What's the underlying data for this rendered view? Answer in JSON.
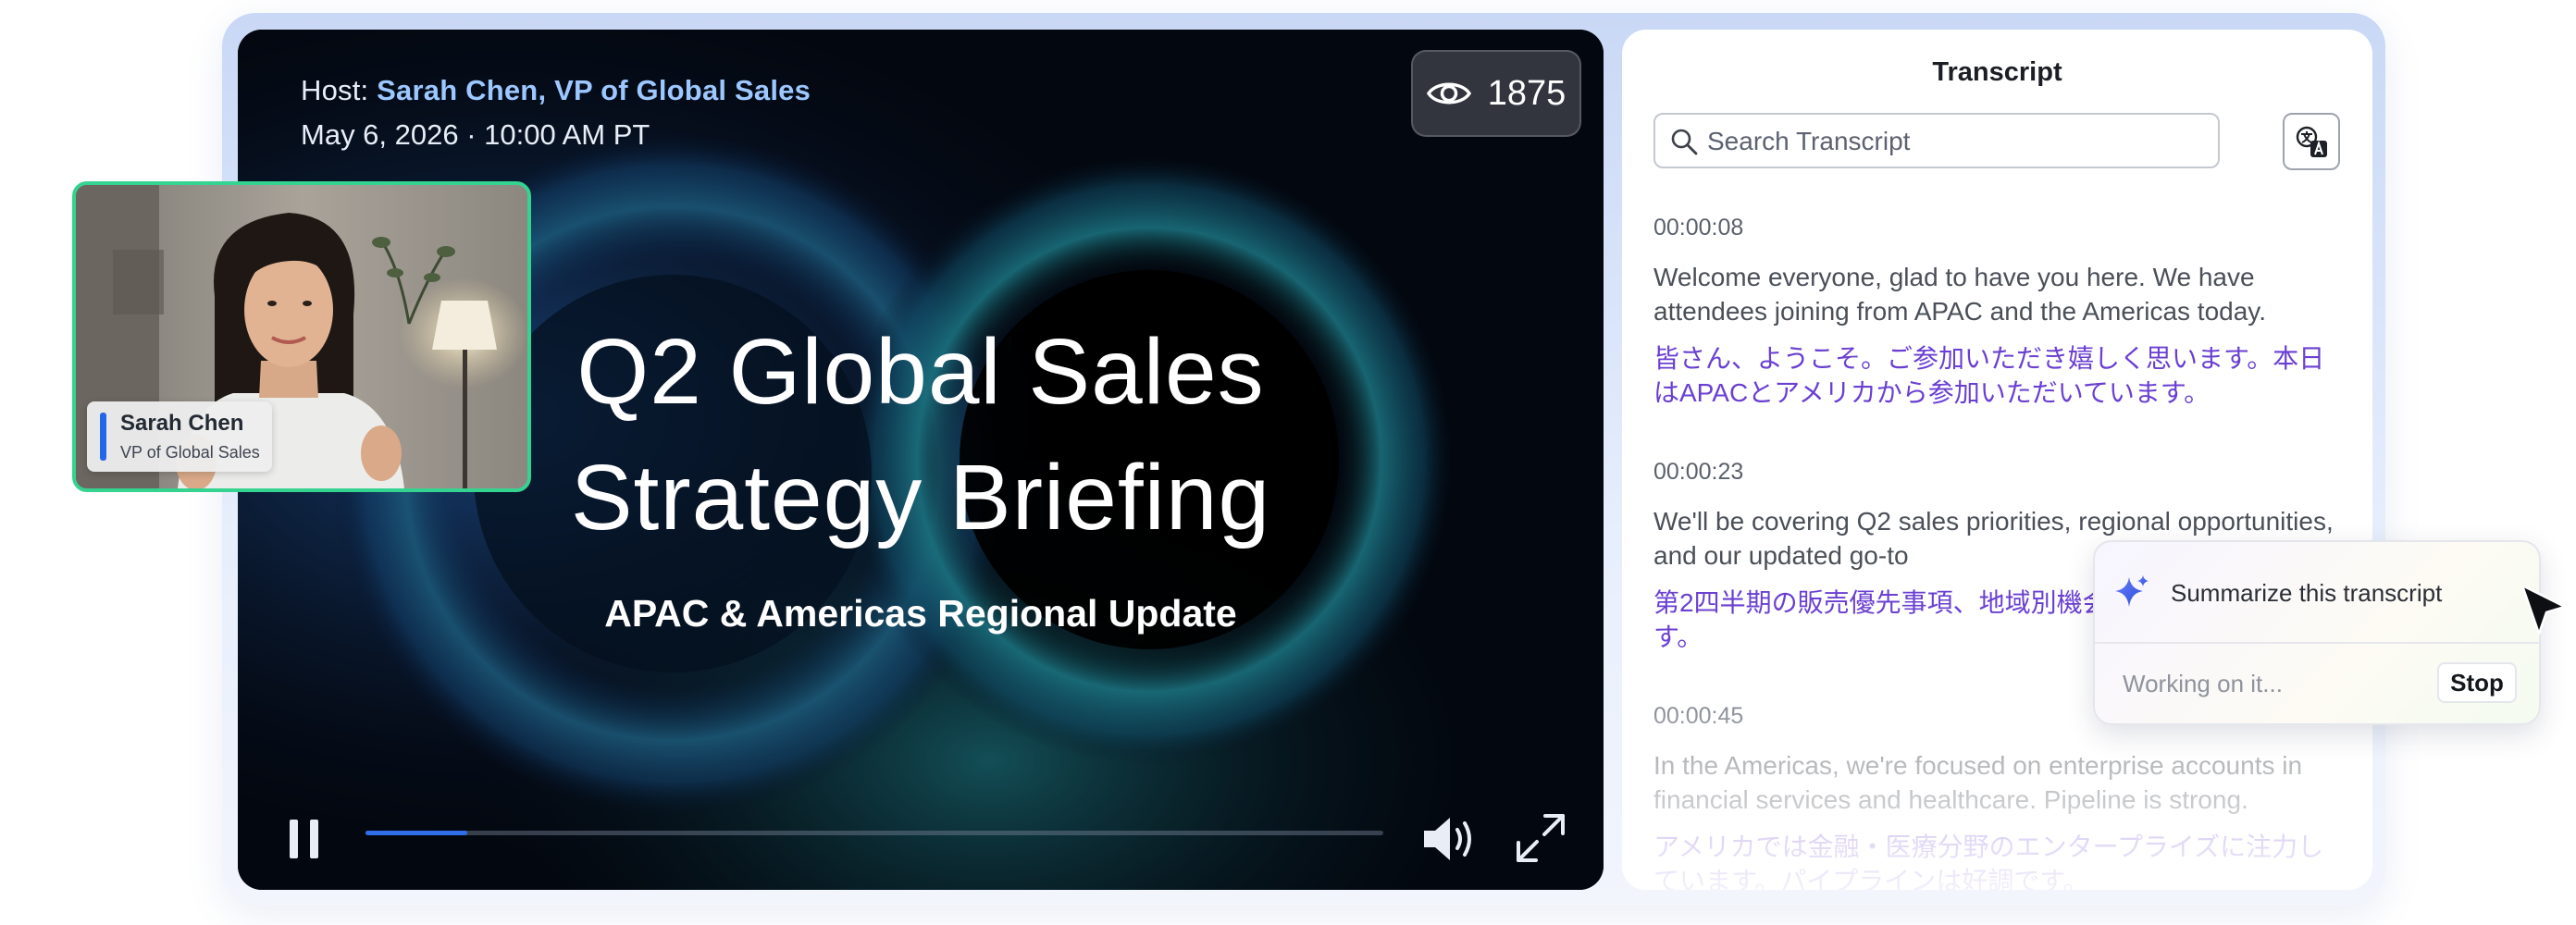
{
  "video": {
    "host_prefix": "Host: ",
    "host_name": "Sarah Chen, VP of Global Sales",
    "date_time": "May 6, 2026 · 10:00 AM PT",
    "viewer_count": "1875",
    "viewer_icon": "eye-icon",
    "title_line1": "Q2 Global Sales",
    "title_line2": "Strategy Briefing",
    "subtitle": "APAC & Americas Regional Update",
    "playback_state": "playing",
    "progress_fraction": 0.1,
    "progress_color": "#2f6ee8",
    "controls": {
      "pause_icon": "pause-icon",
      "volume_icon": "volume-icon",
      "fullscreen_icon": "fullscreen-icon"
    }
  },
  "pip": {
    "name": "Sarah Chen",
    "role": "VP of Global Sales",
    "border_color": "#35d390",
    "accent_color": "#2466ea"
  },
  "transcript": {
    "title": "Transcript",
    "search_placeholder": "Search Transcript",
    "search_value": "",
    "translate_icon": "translate-icon",
    "entries": [
      {
        "timestamp": "00:00:08",
        "text_en": "Welcome everyone, glad to have you here. We have attendees joining from APAC and the Americas today.",
        "text_ja": "皆さん、ようこそ。ご参加いただき嬉しく思います。本日はAPACとアメリカから参加いただいています。"
      },
      {
        "timestamp": "00:00:23",
        "text_en": "We'll be covering Q2 sales priorities, regional opportunities, and our updated go-to",
        "text_ja": "第2四半期の販売優先事項、地域別機会、ついてご説明します。"
      },
      {
        "timestamp": "00:00:45",
        "text_en": "In the Americas, we're focused on enterprise accounts in financial services and healthcare. Pipeline is strong.",
        "text_ja": "アメリカでは金融・医療分野のエンタープライズに注力しています。パイプラインは好調です。"
      }
    ]
  },
  "ai": {
    "summarize_label": "Summarize this transcript",
    "sparkle_icon": "sparkle-icon",
    "status": "Working on it...",
    "stop_label": "Stop"
  },
  "colors": {
    "transcript_translation": "#6a3fd2",
    "host_name": "#9cc7ff"
  }
}
